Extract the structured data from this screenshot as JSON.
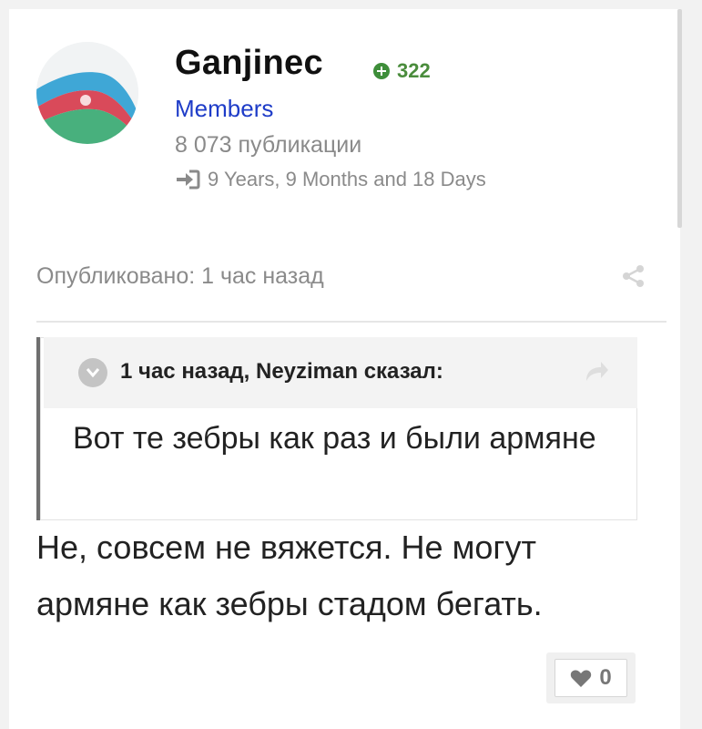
{
  "author": {
    "name": "Ganjinec",
    "reputation": "322",
    "group": "Members",
    "posts": "8 073 публикации",
    "membership": "9 Years, 9 Months and 18 Days",
    "avatar_icon": "azerbaijan-flag-avatar"
  },
  "post": {
    "published": "Опубликовано: 1 час назад",
    "quote": {
      "citation": "1 час назад, Neyziman сказал:",
      "text": "Вот те зебры как раз и были армяне"
    },
    "body": "Не, совсем не вяжется. Не могут армяне как зебры стадом бегать.",
    "reactions": "0"
  },
  "colors": {
    "group_link": "#1e3cc8",
    "reputation": "#4a8c3c",
    "meta_text": "#8a8a8a"
  }
}
